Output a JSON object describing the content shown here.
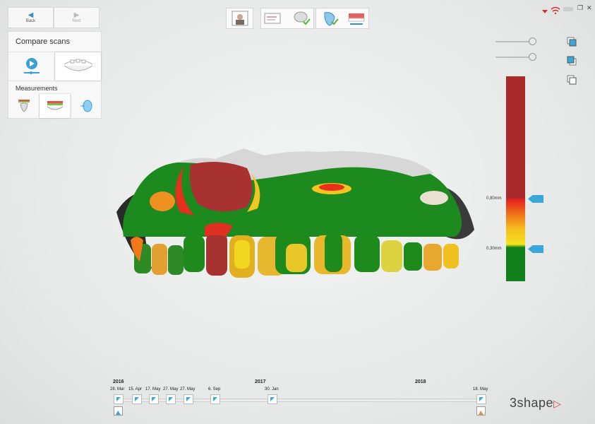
{
  "nav": {
    "back_label": "Back",
    "next_label": "Next"
  },
  "panel": {
    "title": "Compare scans",
    "measurements_label": "Measurements"
  },
  "icons": {
    "back": "arrow-left-icon",
    "next": "arrow-right-icon",
    "play": "play-icon",
    "patient": "patient-photo-icon",
    "minimize": "minimize-icon",
    "restore": "restore-icon",
    "close": "close-icon"
  },
  "window": {
    "minimize": "—",
    "restore": "❐",
    "close": "✕"
  },
  "color_scale": {
    "upper_label": "0,80mm",
    "lower_label": "0,30mm",
    "colors": {
      "red": "#a9282a",
      "orange": "#f07a1a",
      "yellow": "#f4e21d",
      "green": "#12801a"
    }
  },
  "timeline": {
    "years": [
      "2016",
      "2017",
      "2018"
    ],
    "dates": [
      "28. Mar",
      "15. Apr",
      "17. May",
      "27. May",
      "27. May",
      "6. Sep",
      "30. Jan",
      "18. May"
    ]
  },
  "brand": {
    "name": "3shape"
  }
}
